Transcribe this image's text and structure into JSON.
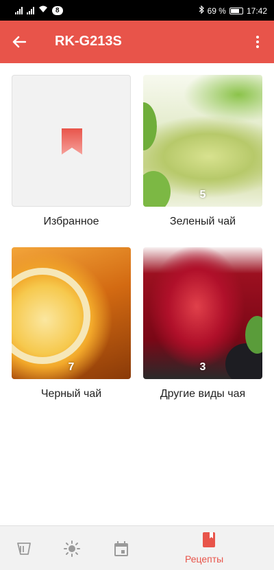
{
  "status_bar": {
    "badge": "8",
    "battery": "69 %",
    "time": "17:42"
  },
  "app_bar": {
    "title": "RK-G213S"
  },
  "categories": [
    {
      "name": "Избранное",
      "count": ""
    },
    {
      "name": "Зеленый чай",
      "count": "5"
    },
    {
      "name": "Черный чай",
      "count": "7"
    },
    {
      "name": "Другие виды чая",
      "count": "3"
    }
  ],
  "bottom_nav": {
    "active_label": "Рецепты",
    "items": [
      "program-icon",
      "sun-icon",
      "calendar-icon",
      "recipes-icon"
    ]
  },
  "colors": {
    "accent": "#e8544a",
    "status_bar": "#000000",
    "nav_background": "#f2f2f2"
  }
}
